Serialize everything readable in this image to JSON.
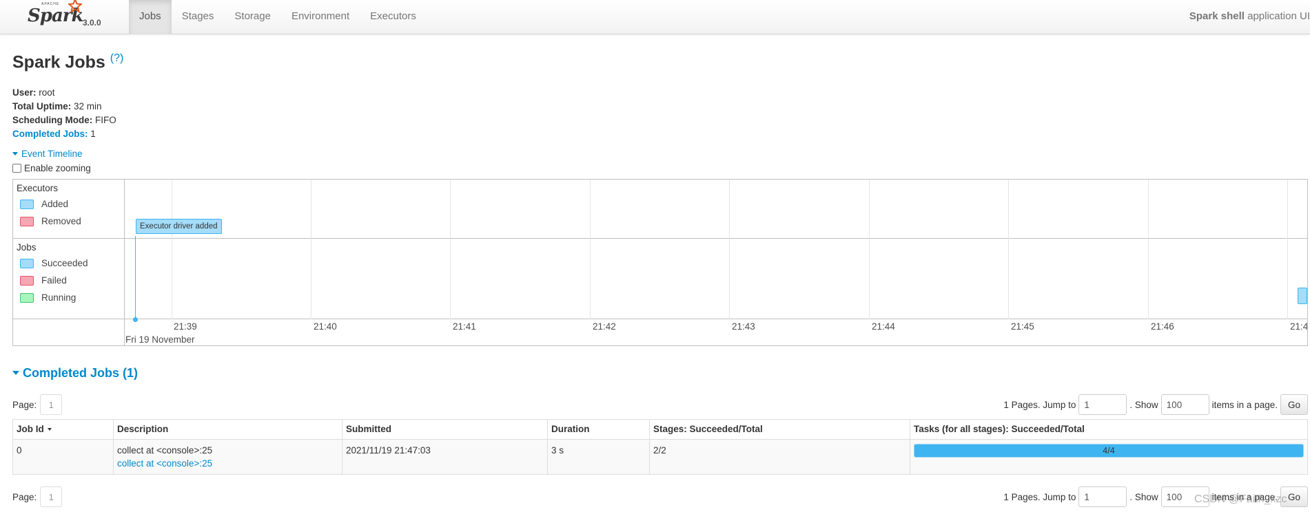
{
  "brand": {
    "apache": "APACHE",
    "name": "Spark",
    "version": "3.0.0"
  },
  "nav": {
    "tabs": [
      "Jobs",
      "Stages",
      "Storage",
      "Environment",
      "Executors"
    ],
    "active_index": 0
  },
  "app": {
    "name_bold": "Spark shell",
    "name_rest": " application UI"
  },
  "page": {
    "title": "Spark Jobs",
    "help": "(?)"
  },
  "summary": {
    "user_label": "User:",
    "user_value": " root",
    "uptime_label": "Total Uptime:",
    "uptime_value": " 32 min",
    "scheduling_label": "Scheduling Mode:",
    "scheduling_value": " FIFO",
    "completed_label": "Completed Jobs:",
    "completed_value": " 1"
  },
  "timeline": {
    "toggle_label": "Event Timeline",
    "zoom_label": "Enable zooming",
    "zoom_checked": false,
    "executors_group": "Executors",
    "executors_legend": [
      {
        "label": "Added",
        "color": "#a4dcf9"
      },
      {
        "label": "Removed",
        "color": "#f7a6b3"
      }
    ],
    "jobs_group": "Jobs",
    "jobs_legend": [
      {
        "label": "Succeeded",
        "color": "#a4dcf9"
      },
      {
        "label": "Failed",
        "color": "#f7a6b3"
      },
      {
        "label": "Running",
        "color": "#a8f5bd"
      }
    ],
    "ticks": [
      "21:39",
      "21:40",
      "21:41",
      "21:42",
      "21:43",
      "21:44",
      "21:45",
      "21:46",
      "21:4"
    ],
    "major_label": "Fri 19 November",
    "event_label": "Executor driver added"
  },
  "completed_jobs": {
    "heading": "Completed Jobs (1)",
    "page_label": "Page:",
    "page_value": "1",
    "pages_text": "1 Pages. Jump to",
    "jump_value": "1",
    "show_text": ". Show",
    "show_value": "100",
    "items_text": "items in a page.",
    "go_label": "Go",
    "columns": [
      "Job Id",
      "Description",
      "Submitted",
      "Duration",
      "Stages: Succeeded/Total",
      "Tasks (for all stages): Succeeded/Total"
    ],
    "rows": [
      {
        "job_id": "0",
        "description": "collect at <console>:25",
        "description_link": "collect at <console>:25",
        "submitted": "2021/11/19 21:47:03",
        "duration": "3 s",
        "stages": "2/2",
        "tasks": "4/4",
        "tasks_fraction": 1.0
      }
    ]
  },
  "watermark": "CSDN @Faith_xzc"
}
